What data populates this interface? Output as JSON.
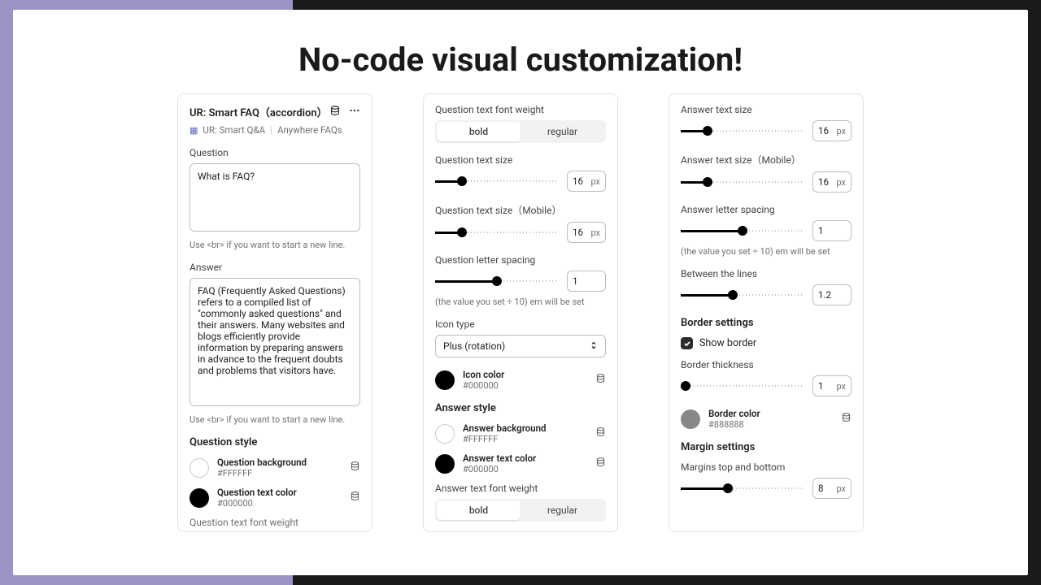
{
  "hero_title": "No-code visual customization!",
  "panel1": {
    "title": "UR: Smart FAQ（accordion）",
    "breadcrumb": {
      "app": "UR: Smart Q&A",
      "section": "Anywhere FAQs"
    },
    "question_label": "Question",
    "question_value": "What is FAQ?",
    "question_hint": "Use <br> if you want to start a new line.",
    "answer_label": "Answer",
    "answer_value": "FAQ (Frequently Asked Questions) refers to a compiled list of \"commonly asked questions\" and their answers. Many websites and blogs efficiently provide information by preparing answers in advance to the frequent doubts and problems that visitors have.",
    "answer_hint": "Use <br> if you want to start a new line.",
    "q_style_title": "Question style",
    "q_bg": {
      "name": "Question background",
      "hex": "#FFFFFF"
    },
    "q_color": {
      "name": "Question text color",
      "hex": "#000000"
    },
    "q_weight_label": "Question text font weight"
  },
  "panel2": {
    "q_weight_label": "Question text font weight",
    "seg": {
      "bold": "bold",
      "regular": "regular"
    },
    "q_size_label": "Question text size",
    "q_size": {
      "val": "16",
      "unit": "px"
    },
    "q_size_m_label": "Question text size（Mobile）",
    "q_size_m": {
      "val": "16",
      "unit": "px"
    },
    "q_ls_label": "Question letter spacing",
    "q_ls": {
      "val": "1"
    },
    "ls_hint": "(the value you set ÷ 10) em will be set",
    "icon_type_label": "Icon type",
    "icon_type_value": "Plus (rotation)",
    "icon_color": {
      "name": "Icon color",
      "hex": "#000000"
    },
    "a_style_title": "Answer style",
    "a_bg": {
      "name": "Answer background",
      "hex": "#FFFFFF"
    },
    "a_color": {
      "name": "Answer text color",
      "hex": "#000000"
    },
    "a_weight_label": "Answer text font weight"
  },
  "panel3": {
    "a_size_label": "Answer text size",
    "a_size": {
      "val": "16",
      "unit": "px"
    },
    "a_size_m_label": "Answer text size（Mobile）",
    "a_size_m": {
      "val": "16",
      "unit": "px"
    },
    "a_ls_label": "Answer letter spacing",
    "a_ls": {
      "val": "1"
    },
    "ls_hint": "(the value you set ÷ 10) em will be set",
    "lines_label": "Between the lines",
    "lines": {
      "val": "1.2"
    },
    "border_title": "Border settings",
    "show_border_label": "Show border",
    "border_thick_label": "Border thickness",
    "border_thick": {
      "val": "1",
      "unit": "px"
    },
    "border_color": {
      "name": "Border color",
      "hex": "#888888"
    },
    "margin_title": "Margin settings",
    "margin_label": "Margins top and bottom",
    "margin": {
      "val": "8",
      "unit": "px"
    }
  }
}
